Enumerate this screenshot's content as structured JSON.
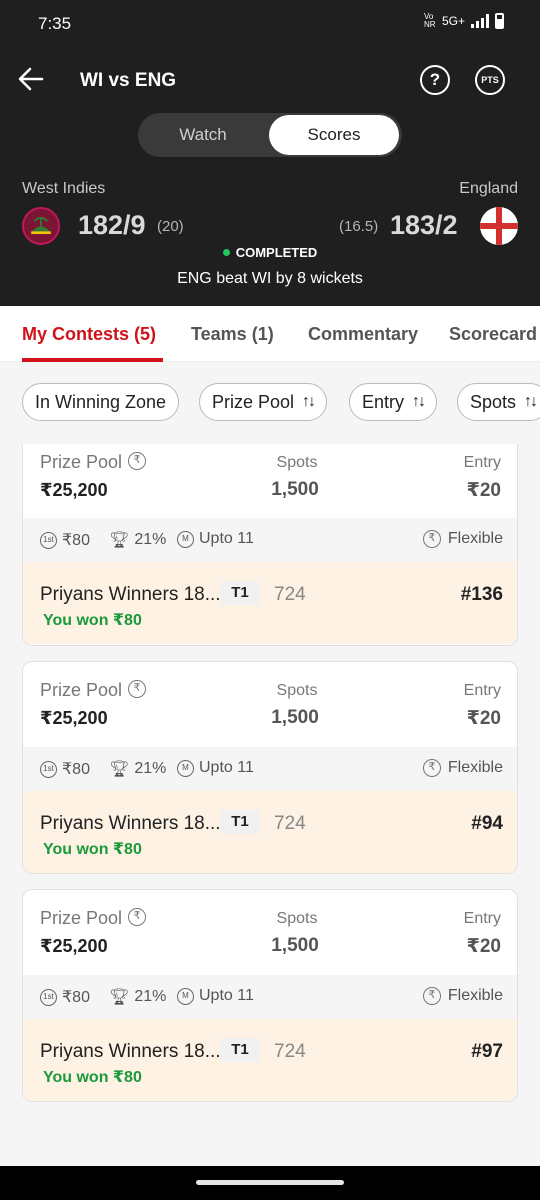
{
  "status_bar": {
    "time": "7:35",
    "volte": "Vo NR",
    "network": "5G+"
  },
  "header": {
    "title": "WI vs ENG",
    "help_icon_glyph": "?",
    "pts_label": "PTS",
    "toggle": {
      "watch": "Watch",
      "scores": "Scores",
      "selected": "Scores"
    }
  },
  "match": {
    "team_left": {
      "name": "West Indies",
      "score": "182/9",
      "overs": "(20)"
    },
    "team_right": {
      "name": "England",
      "score": "183/2",
      "overs": "(16.5)"
    },
    "status": "COMPLETED",
    "status_color": "#22c55e",
    "result": "ENG beat WI by 8 wickets"
  },
  "tabs": [
    {
      "label": "My Contests (5)",
      "active": true
    },
    {
      "label": "Teams (1)",
      "active": false
    },
    {
      "label": "Commentary",
      "active": false
    },
    {
      "label": "Scorecard",
      "active": false
    }
  ],
  "filters": [
    {
      "label": "In Winning Zone",
      "sortable": false
    },
    {
      "label": "Prize Pool",
      "sortable": true
    },
    {
      "label": "Entry",
      "sortable": true
    },
    {
      "label": "Spots",
      "sortable": true
    }
  ],
  "contests": [
    {
      "prize_label": "Prize Pool",
      "prize": "₹25,200",
      "spots_label": "Spots",
      "spots": "1,500",
      "entry_label": "Entry",
      "entry": "₹20",
      "first_prize": "₹80",
      "win_percent": "21%",
      "max_teams": "Upto 11",
      "type": "Flexible",
      "team_name": "Priyans Winners 18...",
      "team_badge": "T1",
      "points": "724",
      "rank": "#136",
      "won": "You won ₹80"
    },
    {
      "prize_label": "Prize Pool",
      "prize": "₹25,200",
      "spots_label": "Spots",
      "spots": "1,500",
      "entry_label": "Entry",
      "entry": "₹20",
      "first_prize": "₹80",
      "win_percent": "21%",
      "max_teams": "Upto 11",
      "type": "Flexible",
      "team_name": "Priyans Winners 18...",
      "team_badge": "T1",
      "points": "724",
      "rank": "#94",
      "won": "You won ₹80"
    },
    {
      "prize_label": "Prize Pool",
      "prize": "₹25,200",
      "spots_label": "Spots",
      "spots": "1,500",
      "entry_label": "Entry",
      "entry": "₹20",
      "first_prize": "₹80",
      "win_percent": "21%",
      "max_teams": "Upto 11",
      "type": "Flexible",
      "team_name": "Priyans Winners 18...",
      "team_badge": "T1",
      "points": "724",
      "rank": "#97",
      "won": "You won ₹80"
    }
  ],
  "icons": {
    "first_prize_glyph": "1st",
    "max_teams_glyph": "M",
    "rupee_glyph": "₹"
  },
  "colors": {
    "accent": "#d0121b",
    "header_bg": "#1f1f1f",
    "won": "#1a9a3a",
    "team_row_bg": "#fdf2e3"
  }
}
